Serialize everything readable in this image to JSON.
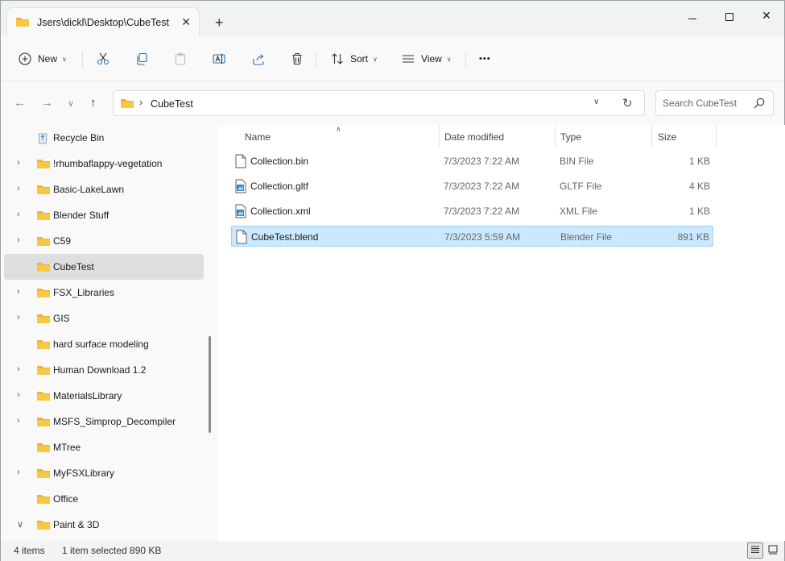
{
  "window": {
    "tab_title": "Jsers\\dickl\\Desktop\\CubeTest",
    "tab_close": "✕",
    "new_tab": "+",
    "minimize": "",
    "maximize": "",
    "close": "✕"
  },
  "toolbar": {
    "new_label": "New",
    "sort_label": "Sort",
    "view_label": "View",
    "more": "•••"
  },
  "address": {
    "separator": "›",
    "crumb": "CubeTest",
    "dropdown": "∨",
    "refresh": "↻"
  },
  "search": {
    "placeholder": "Search CubeTest"
  },
  "nav_glyphs": {
    "back": "←",
    "forward": "→",
    "recent": "∨",
    "up": "↑"
  },
  "sidebar": {
    "items": [
      {
        "label": "Recycle Bin",
        "icon": "recycle-bin-icon",
        "expandable": false
      },
      {
        "label": "!rhumbaflappy-vegetation",
        "icon": "folder-icon",
        "expandable": true
      },
      {
        "label": "Basic-LakeLawn",
        "icon": "folder-icon",
        "expandable": true
      },
      {
        "label": "Blender Stuff",
        "icon": "folder-icon",
        "expandable": true
      },
      {
        "label": "C59",
        "icon": "folder-icon",
        "expandable": true
      },
      {
        "label": "CubeTest",
        "icon": "folder-icon",
        "expandable": false,
        "selected": true
      },
      {
        "label": "FSX_Libraries",
        "icon": "folder-icon",
        "expandable": true
      },
      {
        "label": "GIS",
        "icon": "folder-icon",
        "expandable": true
      },
      {
        "label": "hard surface modeling",
        "icon": "folder-icon",
        "expandable": false
      },
      {
        "label": "Human Download 1.2",
        "icon": "folder-icon",
        "expandable": true
      },
      {
        "label": "MaterialsLibrary",
        "icon": "folder-icon",
        "expandable": true
      },
      {
        "label": "MSFS_Simprop_Decompiler",
        "icon": "folder-icon",
        "expandable": true
      },
      {
        "label": "MTree",
        "icon": "folder-icon",
        "expandable": false
      },
      {
        "label": "MyFSXLibrary",
        "icon": "folder-icon",
        "expandable": true
      },
      {
        "label": "Office",
        "icon": "folder-icon",
        "expandable": false
      },
      {
        "label": "Paint & 3D",
        "icon": "folder-icon",
        "expandable": true,
        "expanded": true
      }
    ]
  },
  "columns": {
    "name": "Name",
    "date": "Date modified",
    "type": "Type",
    "size": "Size"
  },
  "files": [
    {
      "name": "Collection.bin",
      "date": "7/3/2023 7:22 AM",
      "type": "BIN File",
      "size": "1 KB",
      "icon": "file-icon"
    },
    {
      "name": "Collection.gltf",
      "date": "7/3/2023 7:22 AM",
      "type": "GLTF File",
      "size": "4 KB",
      "icon": "gltf-file-icon"
    },
    {
      "name": "Collection.xml",
      "date": "7/3/2023 7:22 AM",
      "type": "XML File",
      "size": "1 KB",
      "icon": "xml-file-icon"
    },
    {
      "name": "CubeTest.blend",
      "date": "7/3/2023 5:59 AM",
      "type": "Blender File",
      "size": "891 KB",
      "icon": "file-icon",
      "selected": true
    }
  ],
  "status": {
    "items": "4 items",
    "selection": "1 item selected  890 KB"
  },
  "colors": {
    "folder": "#f7c844",
    "selection": "#cce8ff",
    "selection_border": "#99d1ff",
    "sidebar_selected": "#dedede"
  }
}
